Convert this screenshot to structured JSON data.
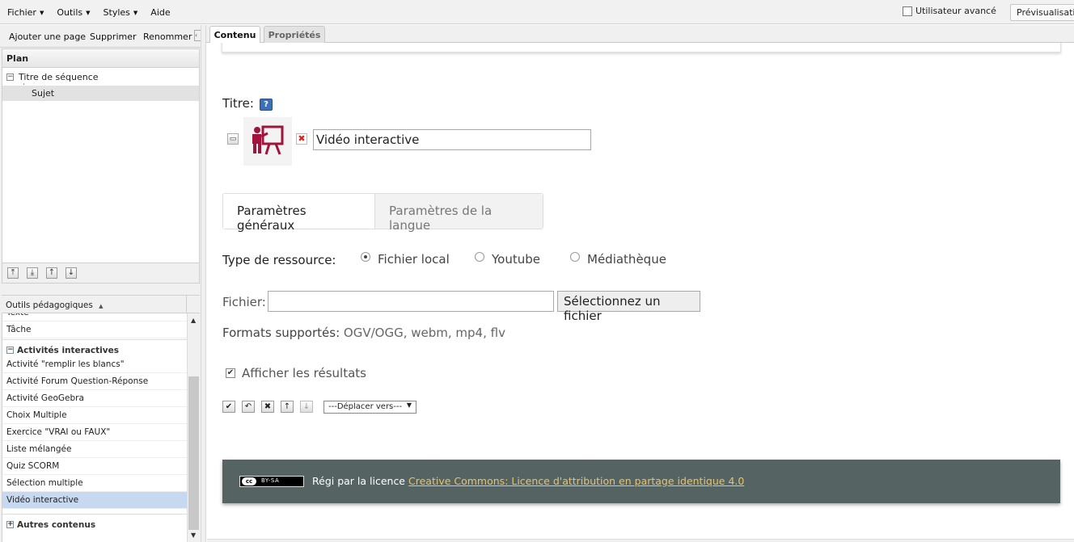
{
  "menubar": {
    "items": [
      "Fichier",
      "Outils",
      "Styles",
      "Aide"
    ],
    "advanced_user": "Utilisateur avancé",
    "preview": "Prévisualisation"
  },
  "left": {
    "toolbar": {
      "add_page": "Ajouter une page",
      "delete": "Supprimer",
      "rename": "Renommer"
    },
    "plan": {
      "title": "Plan",
      "root": "Titre de séquence",
      "child": "Sujet"
    },
    "outils": {
      "title": "Outils pédagogiques",
      "cut_item": "Texte",
      "item_tache": "Tâche",
      "category_interactive": "Activités interactives",
      "items": [
        "Activité \"remplir les blancs\"",
        "Activité Forum Question-Réponse",
        "Activité GeoGebra",
        "Choix Multiple",
        "Exercice \"VRAI ou FAUX\"",
        "Liste mélangée",
        "Quiz SCORM",
        "Sélection multiple",
        "Vidéo interactive"
      ],
      "selected_index": 8,
      "category_other": "Autres contenus"
    }
  },
  "tabs": {
    "content": "Contenu",
    "properties": "Propriétés"
  },
  "editor": {
    "title_label": "Titre:",
    "help": "?",
    "title_value": "Vidéo interactive",
    "subtabs": {
      "general": "Paramètres généraux",
      "language": "Paramètres de la langue"
    },
    "resource_type_label": "Type de ressource:",
    "resource_options": [
      "Fichier local",
      "Youtube",
      "Médiathèque"
    ],
    "resource_selected": "Fichier local",
    "file_label": "Fichier:",
    "file_value": "",
    "file_button": "Sélectionnez un fichier",
    "formats_key": "Formats supportés:",
    "formats_value": "OGV/OGG, webm, mp4, flv",
    "show_results": "Afficher les résultats",
    "show_results_checked": true,
    "move_select": "---Déplacer vers---"
  },
  "license": {
    "badge": "BY-SA",
    "badge_cc": "cc",
    "prefix": "Régi par la licence",
    "link": "Creative Commons: Licence d'attribution en partage identique 4.0"
  },
  "colors": {
    "license_bg": "#566363",
    "link": "#e8c36b",
    "selected_row": "#c7d9f0",
    "idevice_icon": "#a0143c"
  }
}
